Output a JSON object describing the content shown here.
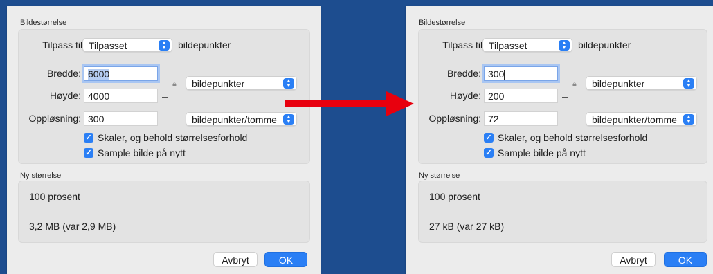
{
  "colors": {
    "background": "#1d4d8f",
    "accent": "#2a7ff5",
    "arrow": "#e8000e"
  },
  "left": {
    "section_image_size": "Bildestørrelse",
    "fit_label": "Tilpass til:",
    "fit_value": "Tilpasset",
    "fit_unit": "bildepunkter",
    "width_label": "Bredde:",
    "width_value": "6000",
    "height_label": "Høyde:",
    "height_value": "4000",
    "size_unit": "bildepunkter",
    "resolution_label": "Oppløsning:",
    "resolution_value": "300",
    "resolution_unit": "bildepunkter/tomme",
    "scale_proportionally": "Skaler, og behold størrelsesforhold",
    "resample": "Sample bilde på nytt",
    "section_new_size": "Ny størrelse",
    "percent": "100 prosent",
    "filesize": "3,2 MB (var 2,9 MB)",
    "cancel": "Avbryt",
    "ok": "OK"
  },
  "right": {
    "section_image_size": "Bildestørrelse",
    "fit_label": "Tilpass til:",
    "fit_value": "Tilpasset",
    "fit_unit": "bildepunkter",
    "width_label": "Bredde:",
    "width_value": "300",
    "height_label": "Høyde:",
    "height_value": "200",
    "size_unit": "bildepunkter",
    "resolution_label": "Oppløsning:",
    "resolution_value": "72",
    "resolution_unit": "bildepunkter/tomme",
    "scale_proportionally": "Skaler, og behold størrelsesforhold",
    "resample": "Sample bilde på nytt",
    "section_new_size": "Ny størrelse",
    "percent": "100 prosent",
    "filesize": "27 kB (var 27 kB)",
    "cancel": "Avbryt",
    "ok": "OK"
  },
  "icons": {
    "lock": "lock-icon",
    "checkbox": "checkmark-icon",
    "stepper": "updown-chevron-icon",
    "arrow": "right-arrow-icon"
  }
}
